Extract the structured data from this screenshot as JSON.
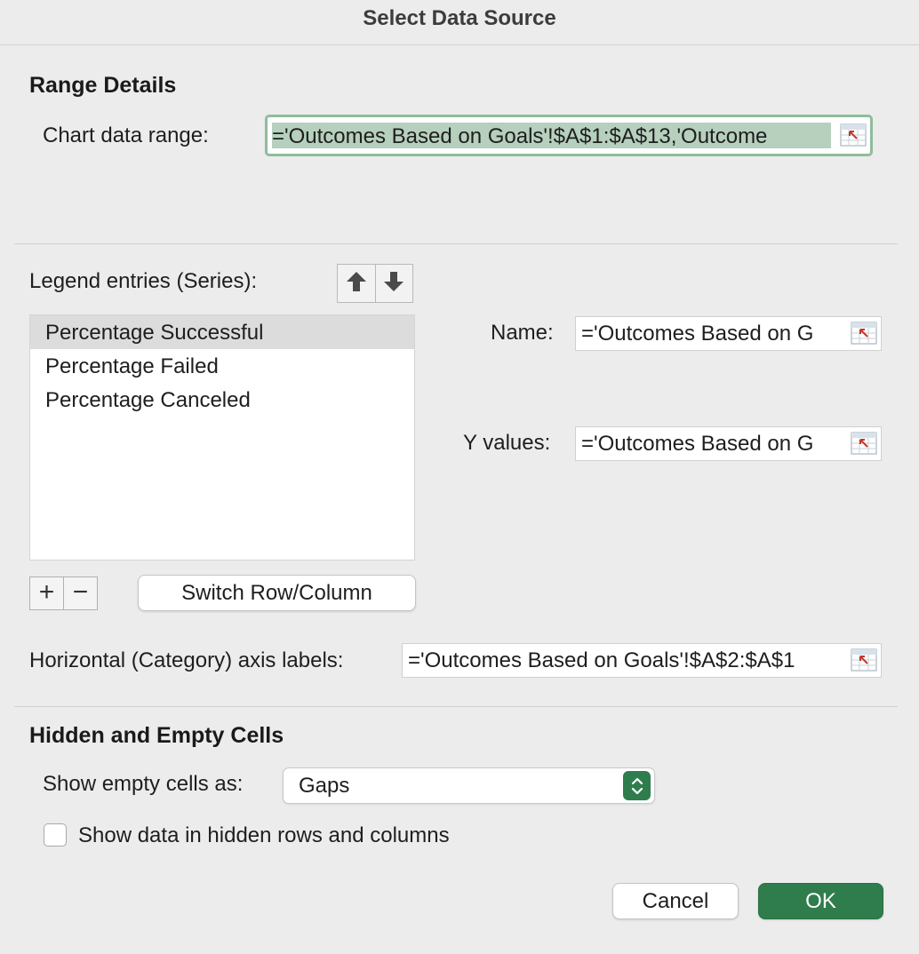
{
  "window": {
    "title": "Select Data Source"
  },
  "range_details": {
    "heading": "Range Details",
    "chart_data_range_label": "Chart data range:",
    "chart_data_range_value": "='Outcomes Based on Goals'!$A$1:$A$13,'Outcome"
  },
  "series": {
    "label": "Legend entries (Series):",
    "items": [
      "Percentage Successful",
      "Percentage Failed",
      "Percentage Canceled"
    ],
    "selected_index": 0,
    "name_label": "Name:",
    "name_value": "='Outcomes Based on G",
    "y_values_label": "Y values:",
    "y_values_value": "='Outcomes Based on G",
    "add_symbol": "+",
    "remove_symbol": "−",
    "switch_button": "Switch Row/Column"
  },
  "category_axis": {
    "label": "Horizontal (Category) axis labels:",
    "value": "='Outcomes Based on Goals'!$A$2:$A$1"
  },
  "hidden_empty": {
    "heading": "Hidden and Empty Cells",
    "show_empty_label": "Show empty cells as:",
    "show_empty_value": "Gaps",
    "show_hidden_label": "Show data in hidden rows and columns",
    "show_hidden_checked": false
  },
  "buttons": {
    "cancel": "Cancel",
    "ok": "OK"
  },
  "colors": {
    "accent": "#2f7d4d",
    "range_highlight": "#b6d0bd",
    "range_border": "#8fbc9a"
  },
  "icons": {
    "collapse": "collapse-dialog-icon",
    "up": "arrow-up-icon",
    "down": "arrow-down-icon",
    "stepper": "chevron-up-down-icon"
  }
}
